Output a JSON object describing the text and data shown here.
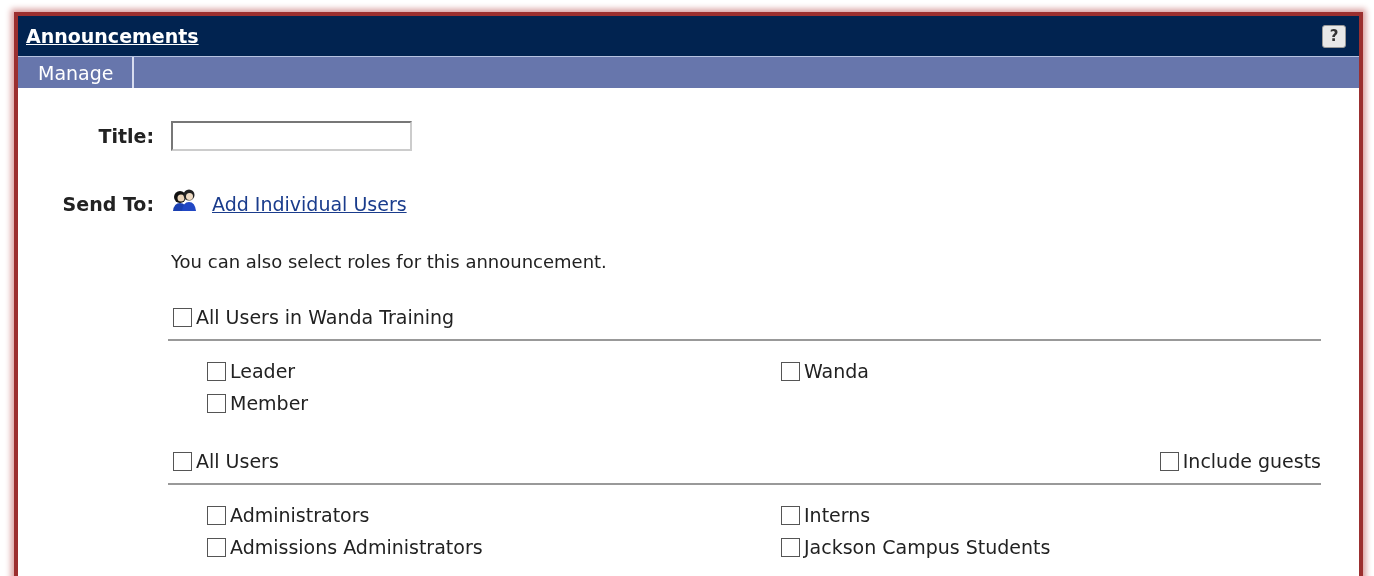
{
  "header": {
    "title": "Announcements",
    "help": "?"
  },
  "tabs": [
    {
      "label": "Manage"
    }
  ],
  "form": {
    "title_label": "Title:",
    "send_to_label": "Send To:",
    "add_users_link": "Add Individual Users",
    "roles_hint": "You can also select roles for this announcement."
  },
  "groups": [
    {
      "label": "All Users in Wanda Training",
      "checked": false,
      "columns": [
        [
          {
            "label": "Leader",
            "checked": false
          },
          {
            "label": "Member",
            "checked": false
          }
        ],
        [
          {
            "label": "Wanda",
            "checked": false
          }
        ]
      ]
    },
    {
      "label": "All Users",
      "checked": false,
      "extra": {
        "label": "Include guests",
        "checked": false
      },
      "columns": [
        [
          {
            "label": "Administrators",
            "checked": false
          },
          {
            "label": "Admissions Administrators",
            "checked": false
          }
        ],
        [
          {
            "label": "Interns",
            "checked": false
          },
          {
            "label": "Jackson Campus Students",
            "checked": false
          }
        ]
      ]
    }
  ]
}
